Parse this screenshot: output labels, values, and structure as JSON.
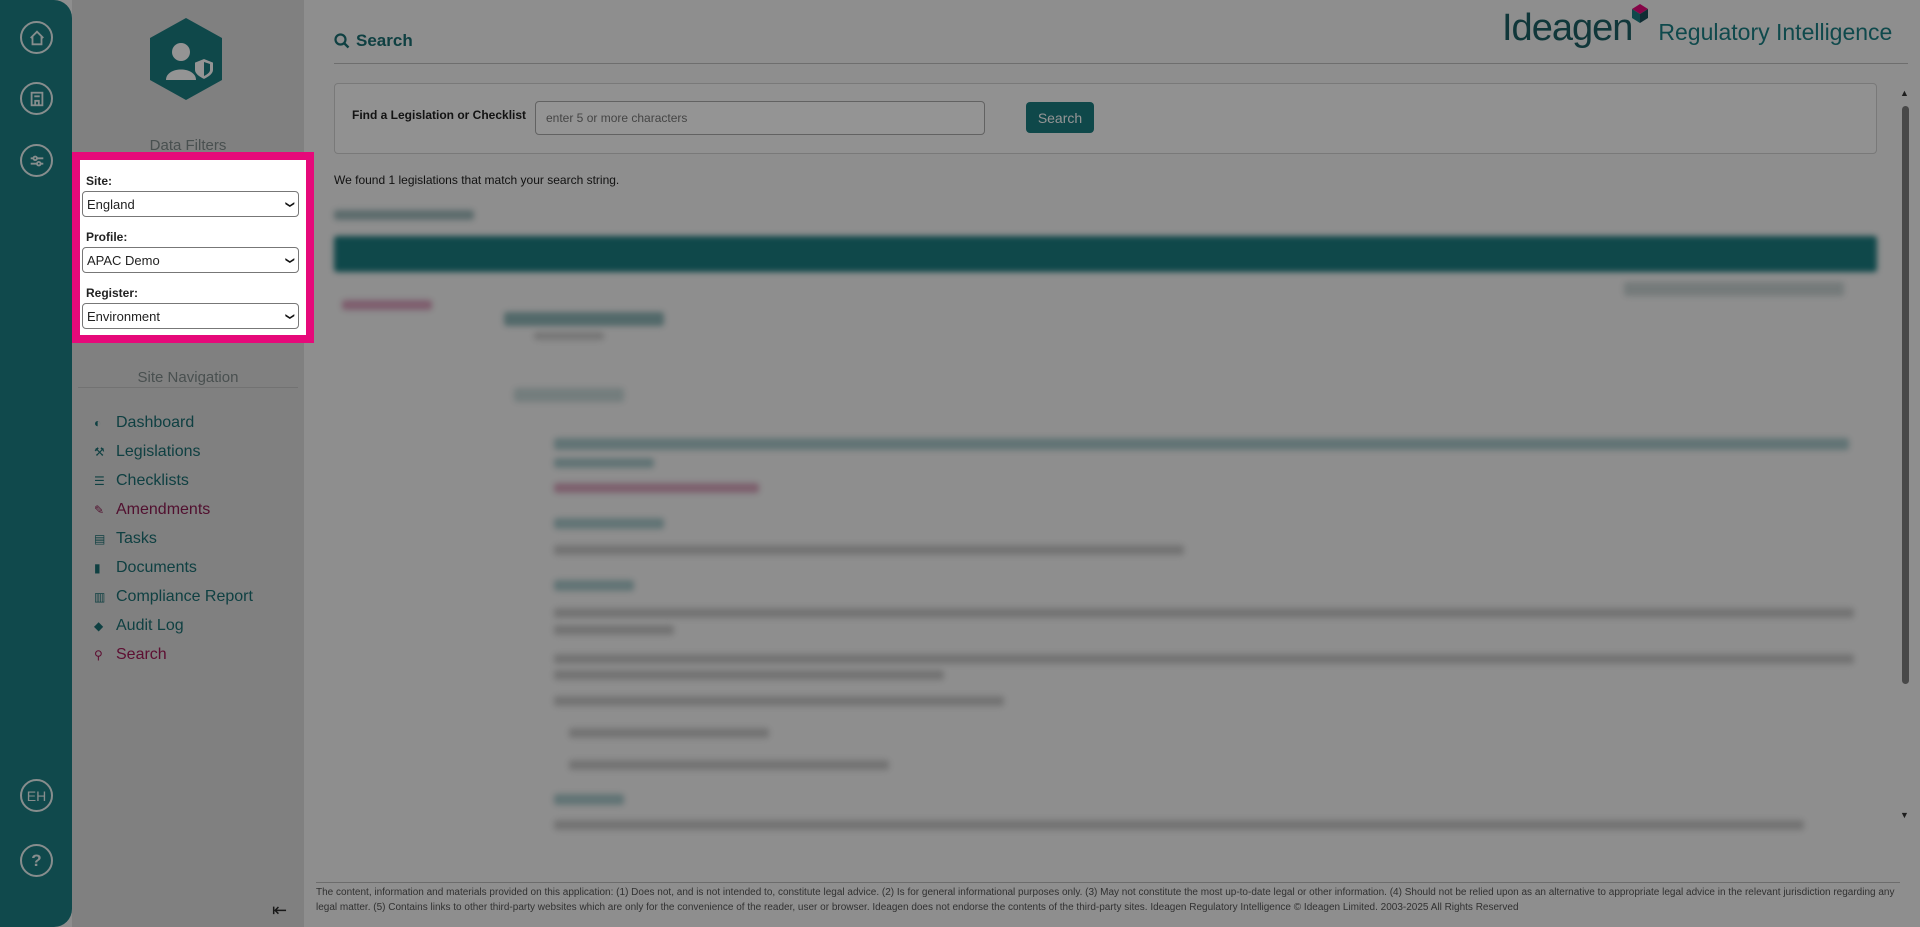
{
  "rail": {
    "icons": [
      "home-icon",
      "building-icon",
      "sliders-icon"
    ],
    "user_initials": "EH",
    "help_label": "?"
  },
  "sidebar": {
    "filters_title": "Data Filters",
    "site_label": "Site:",
    "site_value": "England",
    "profile_label": "Profile:",
    "profile_value": "APAC Demo",
    "register_label": "Register:",
    "register_value": "Environment",
    "nav_title": "Site Navigation",
    "nav": [
      {
        "label": "Dashboard",
        "icon": "dashboard-icon"
      },
      {
        "label": "Legislations",
        "icon": "gavel-icon"
      },
      {
        "label": "Checklists",
        "icon": "list-icon"
      },
      {
        "label": "Amendments",
        "icon": "edit-icon"
      },
      {
        "label": "Tasks",
        "icon": "tasks-icon"
      },
      {
        "label": "Documents",
        "icon": "document-icon"
      },
      {
        "label": "Compliance Report",
        "icon": "bar-chart-icon"
      },
      {
        "label": "Audit Log",
        "icon": "tags-icon"
      },
      {
        "label": "Search",
        "icon": "search-icon"
      }
    ],
    "collapse_icon": "collapse-left-icon"
  },
  "header": {
    "title": "Search",
    "brand_name": "Ideagen",
    "brand_product": "Regulatory Intelligence"
  },
  "search": {
    "label": "Find a Legislation or Checklist",
    "placeholder": "enter 5 or more characters",
    "button": "Search"
  },
  "result_text": "We found 1 legislations that match your search string.",
  "disclaimer": "The content, information and materials provided on this application: (1) Does not, and is not intended to, constitute legal advice. (2) Is for general informational purposes only. (3) May not constitute the most up-to-date legal or other information. (4) Should not be relied upon as an alternative to appropriate legal advice in the relevant jurisdiction regarding any legal matter. (5) Contains links to other third-party websites which are only for the convenience of the reader, user or browser. Ideagen does not endorse the contents of the third-party sites. Ideagen Regulatory Intelligence © Ideagen Limited. 2003-2025 All Rights Reserved",
  "colors": {
    "teal": "#1d7f83",
    "highlight": "#e6097a",
    "amendments": "#8c1d52"
  }
}
